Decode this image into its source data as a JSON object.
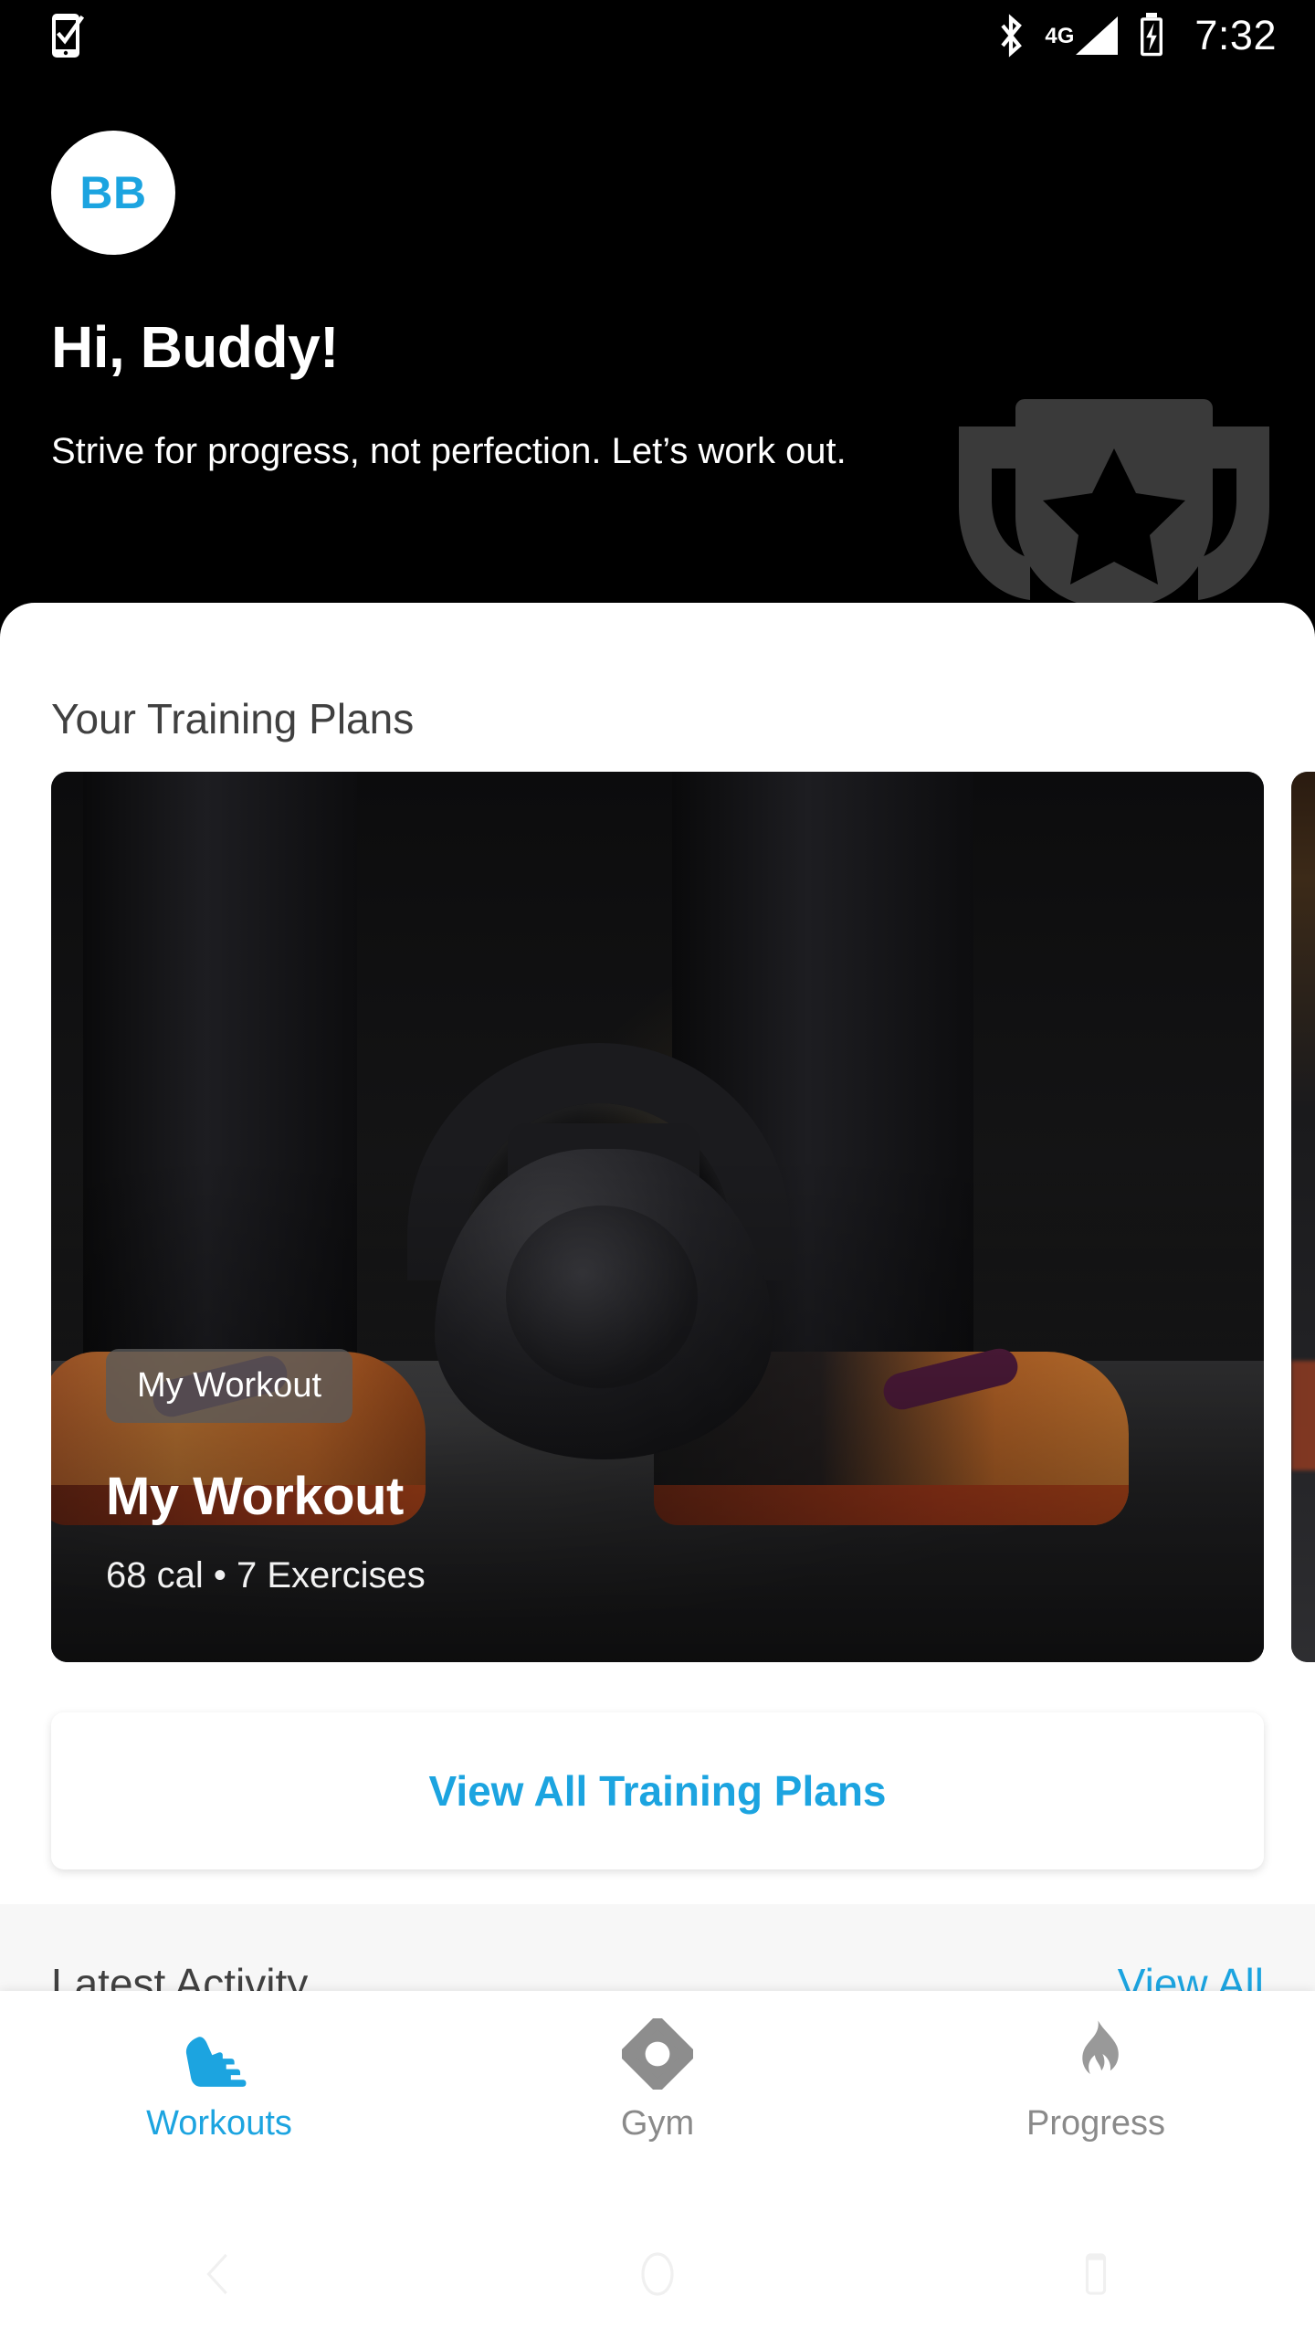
{
  "status_bar": {
    "notification_icon": "phone-check-icon",
    "bluetooth_icon": "bluetooth-icon",
    "network_label": "4G",
    "signal_icon": "signal-bars-icon",
    "battery_icon": "battery-charging-icon",
    "time": "7:32"
  },
  "header": {
    "avatar_initials": "BB",
    "greeting": "Hi, Buddy!",
    "tagline": "Strive for progress, not perfection. Let’s work out.",
    "decoration_icon": "trophy-icon"
  },
  "training_plans": {
    "section_title": "Your Training Plans",
    "cards": [
      {
        "chip": "My Workout",
        "title": "My Workout",
        "meta": "68 cal • 7 Exercises",
        "calories": "68 cal",
        "exercises": "7 Exercises",
        "image_alt": "kettlebell-on-gym-floor"
      },
      {
        "image_alt": "gym-interior-warm-light"
      }
    ],
    "view_all_button": "View All Training Plans"
  },
  "latest_activity": {
    "title": "Latest Activity",
    "view_all": "View All"
  },
  "bottom_nav": {
    "items": [
      {
        "label": "Workouts",
        "icon": "running-shoe-icon",
        "active": true
      },
      {
        "label": "Gym",
        "icon": "gym-diamond-icon",
        "active": false
      },
      {
        "label": "Progress",
        "icon": "flame-icon",
        "active": false
      }
    ]
  },
  "system_nav": {
    "back": "back-chevron-icon",
    "home": "home-circle-icon",
    "recents": "recents-square-icon"
  },
  "colors": {
    "accent": "#1CA4E0",
    "header_bg": "#000000",
    "sheet_bg": "#FFFFFF",
    "muted_text": "#8A8A8A",
    "heading_text": "#404040",
    "activity_bg": "#F7F7F7"
  }
}
